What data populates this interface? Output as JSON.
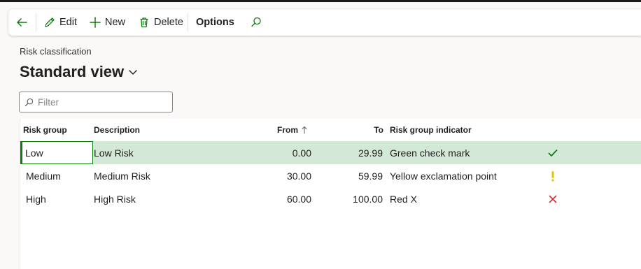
{
  "toolbar": {
    "back_icon": "arrow-left-icon",
    "edit_label": "Edit",
    "new_label": "New",
    "delete_label": "Delete",
    "options_label": "Options",
    "colors": {
      "accent": "#107c10"
    }
  },
  "breadcrumb": "Risk classification",
  "view": {
    "title": "Standard view"
  },
  "filter": {
    "placeholder": "Filter",
    "value": ""
  },
  "grid": {
    "columns": {
      "risk_group": "Risk group",
      "description": "Description",
      "from": "From",
      "to": "To",
      "indicator": "Risk group indicator"
    },
    "sort": {
      "column": "from",
      "direction": "ascending"
    },
    "rows": [
      {
        "risk_group": "Low",
        "description": "Low Risk",
        "from": "0.00",
        "to": "29.99",
        "indicator": "Green check mark",
        "icon": "check-mark-icon",
        "icon_color": "#107c10",
        "selected": true
      },
      {
        "risk_group": "Medium",
        "description": "Medium Risk",
        "from": "30.00",
        "to": "59.99",
        "indicator": "Yellow exclamation point",
        "icon": "exclamation-icon",
        "icon_color": "#e5c400",
        "selected": false
      },
      {
        "risk_group": "High",
        "description": "High Risk",
        "from": "60.00",
        "to": "100.00",
        "indicator": "Red X",
        "icon": "x-mark-icon",
        "icon_color": "#d13438",
        "selected": false
      }
    ]
  }
}
